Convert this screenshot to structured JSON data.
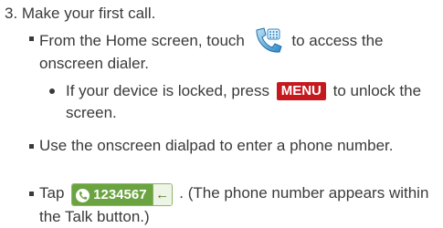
{
  "step": {
    "title": "3. Make your first call."
  },
  "bullets": {
    "b1_before": "From the Home screen, touch",
    "b1_after": "to access the onscreen dialer.",
    "sub1_before": "If your device is locked, press",
    "menu_key": "MENU",
    "sub1_after": "to unlock the screen.",
    "b2": "Use the onscreen dialpad to enter a phone number.",
    "b3_before": "Tap",
    "talk_number": "1234567",
    "backspace_symbol": "←",
    "b3_after": ". (The phone number appears within the Talk button.)"
  },
  "icons": {
    "phone_app_icon": "phone-dialer-app-icon",
    "handset": "handset-icon",
    "backspace": "backspace-icon"
  },
  "colors": {
    "text": "#3a3a3a",
    "menu_key_bg": "#c5191f",
    "talk_green": "#6aa340"
  }
}
